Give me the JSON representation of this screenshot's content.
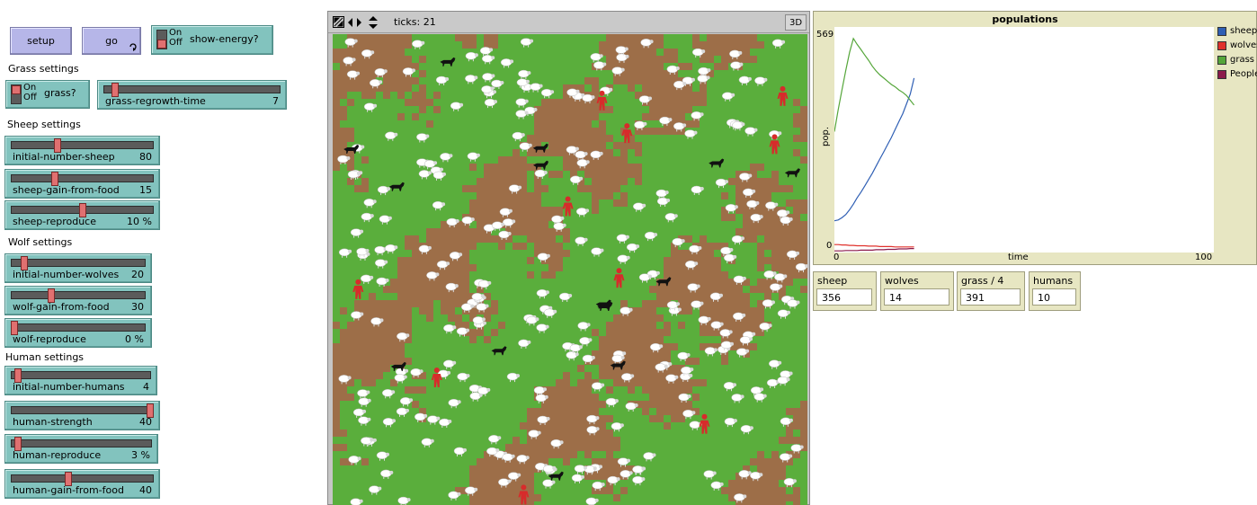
{
  "controls": {
    "setup_label": "setup",
    "go_label": "go",
    "go_icon": "forever-loop-icon",
    "show_energy": {
      "label": "show-energy?",
      "on": "On",
      "off": "Off",
      "state": "off"
    }
  },
  "sections": {
    "grass": "Grass settings",
    "sheep": "Sheep settings",
    "wolf": "Wolf settings",
    "human": "Human settings"
  },
  "grass_switch": {
    "label": "grass?",
    "on": "On",
    "off": "Off",
    "state": "off"
  },
  "sliders": {
    "grass_regrowth_time": {
      "label": "grass-regrowth-time",
      "value": "7",
      "fraction": 0.05
    },
    "initial_number_sheep": {
      "label": "initial-number-sheep",
      "value": "80",
      "fraction": 0.32
    },
    "sheep_gain_from_food": {
      "label": "sheep-gain-from-food",
      "value": "15",
      "fraction": 0.3
    },
    "sheep_reproduce": {
      "label": "sheep-reproduce",
      "value": "10 %",
      "fraction": 0.5
    },
    "initial_number_wolves": {
      "label": "initial-number-wolves",
      "value": "20",
      "fraction": 0.08
    },
    "wolf_gain_from_food": {
      "label": "wolf-gain-from-food",
      "value": "30",
      "fraction": 0.29
    },
    "wolf_reproduce": {
      "label": "wolf-reproduce",
      "value": "0 %",
      "fraction": 0.0
    },
    "initial_number_humans": {
      "label": "initial-number-humans",
      "value": "4",
      "fraction": 0.03
    },
    "human_strength": {
      "label": "human-strength",
      "value": "40",
      "fraction": 1.0
    },
    "human_reproduce": {
      "label": "human-reproduce",
      "value": "3 %",
      "fraction": 0.03
    },
    "human_gain_from_food": {
      "label": "human-gain-from-food",
      "value": "40",
      "fraction": 0.4
    }
  },
  "view": {
    "ticks_label": "ticks: 21",
    "three_d_label": "3D",
    "colors": {
      "grass": "#5aae3c",
      "dirt": "#9d6e48",
      "sheep": "#ffffff",
      "wolf": "#111111",
      "human": "#d72b2b"
    }
  },
  "plot": {
    "title": "populations",
    "y_axis_label": "pop.",
    "x_axis_label": "time",
    "y_max_label": "569",
    "y_min_label": "0",
    "x_min_label": "0",
    "x_max_label": "100",
    "legend": [
      {
        "name": "sheep",
        "color": "#2f5fb4"
      },
      {
        "name": "wolves",
        "color": "#e0312b"
      },
      {
        "name": "grass",
        "color": "#55a63a"
      },
      {
        "name": "People",
        "color": "#8b1a4a"
      }
    ]
  },
  "chart_data": {
    "type": "line",
    "title": "populations",
    "xlabel": "time",
    "ylabel": "pop.",
    "xlim": [
      0,
      100
    ],
    "ylim": [
      0,
      569
    ],
    "series": [
      {
        "name": "sheep",
        "color": "#2f5fb4",
        "x": [
          0,
          1,
          2,
          3,
          4,
          5,
          6,
          7,
          8,
          9,
          10,
          11,
          12,
          13,
          14,
          15,
          16,
          17,
          18,
          19,
          20,
          21
        ],
        "values": [
          80,
          82,
          88,
          96,
          108,
          122,
          138,
          152,
          168,
          184,
          200,
          218,
          236,
          254,
          272,
          290,
          310,
          330,
          350,
          375,
          400,
          440
        ]
      },
      {
        "name": "wolves",
        "color": "#e0312b",
        "x": [
          0,
          1,
          2,
          3,
          4,
          5,
          6,
          7,
          8,
          9,
          10,
          11,
          12,
          13,
          14,
          15,
          16,
          17,
          18,
          19,
          20,
          21
        ],
        "values": [
          20,
          20,
          19,
          19,
          18,
          18,
          17,
          17,
          17,
          16,
          16,
          16,
          15,
          15,
          15,
          15,
          14,
          14,
          14,
          14,
          14,
          14
        ]
      },
      {
        "name": "grass",
        "color": "#55a63a",
        "x": [
          0,
          1,
          2,
          3,
          4,
          5,
          6,
          7,
          8,
          9,
          10,
          11,
          12,
          13,
          14,
          15,
          16,
          17,
          18,
          19,
          20,
          21
        ],
        "values": [
          305,
          360,
          410,
          460,
          505,
          540,
          525,
          512,
          498,
          485,
          470,
          458,
          448,
          440,
          432,
          424,
          418,
          410,
          404,
          396,
          384,
          372
        ]
      },
      {
        "name": "People",
        "color": "#8b1a4a",
        "x": [
          0,
          1,
          2,
          3,
          4,
          5,
          6,
          7,
          8,
          9,
          10,
          11,
          12,
          13,
          14,
          15,
          16,
          17,
          18,
          19,
          20,
          21
        ],
        "values": [
          4,
          4,
          4,
          5,
          5,
          5,
          5,
          6,
          6,
          6,
          6,
          7,
          7,
          7,
          8,
          8,
          8,
          9,
          9,
          9,
          10,
          10
        ]
      }
    ]
  },
  "monitors": [
    {
      "label": "sheep",
      "value": "356"
    },
    {
      "label": "wolves",
      "value": "14"
    },
    {
      "label": "grass / 4",
      "value": "391"
    },
    {
      "label": "humans",
      "value": "10"
    }
  ]
}
